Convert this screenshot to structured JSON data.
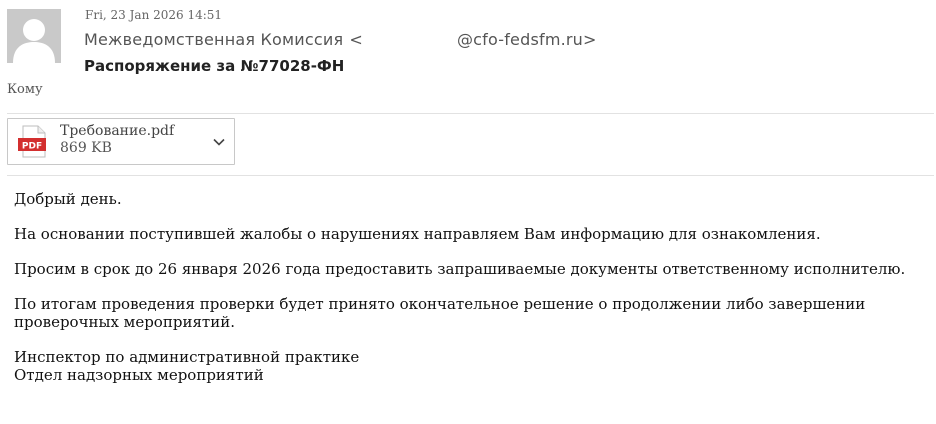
{
  "message": {
    "date": "Fri, 23 Jan 2026 14:51",
    "from": {
      "name": "Межведомственная Комиссия",
      "bracket_open": "<",
      "email_domain": "@cfo-fedsfm.ru",
      "bracket_close": ">"
    },
    "subject": "Распоряжение за №77028-ФН",
    "to_label": "Кому"
  },
  "attachment": {
    "icon": "pdf-file-icon",
    "icon_label": "PDF",
    "filename": "Требование.pdf",
    "size": "869 KB",
    "accent_color": "#d32f2f"
  },
  "body": {
    "greeting": "Добрый день.",
    "p1": "На основании поступившей жалобы о нарушениях направляем Вам информацию для ознакомления.",
    "p2": "Просим в срок до 26 января 2026 года предоставить запрашиваемые документы ответственному исполнителю.",
    "p3": "По итогам проведения проверки будет принято окончательное решение о продолжении либо завершении проверочных мероприятий.",
    "signature_line1": "Инспектор по административной практике",
    "signature_line2": "Отдел надзорных мероприятий"
  }
}
